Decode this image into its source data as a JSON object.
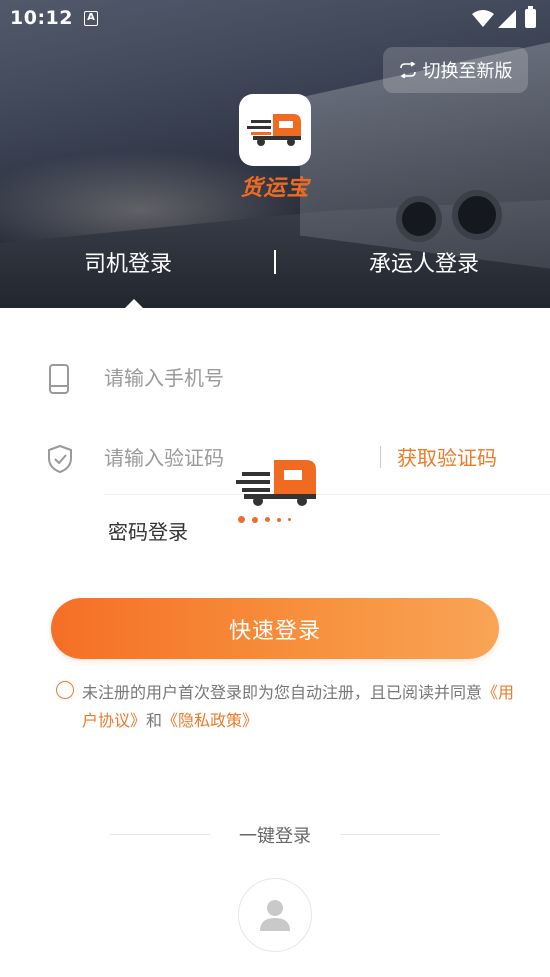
{
  "status_bar": {
    "time": "10:12",
    "notif_letter": "A"
  },
  "header": {
    "switch_version_label": "切换至新版",
    "logo_text": "货运宝",
    "tabs": [
      {
        "label": "司机登录",
        "active": true
      },
      {
        "label": "承运人登录",
        "active": false
      }
    ]
  },
  "form": {
    "phone": {
      "placeholder": "请输入手机号",
      "value": ""
    },
    "code": {
      "placeholder": "请输入验证码",
      "value": "",
      "get_code_label": "获取验证码"
    },
    "password_login_label": "密码登录",
    "submit_label": "快速登录"
  },
  "agreement": {
    "text_before": "未注册的用户首次登录即为您自动注册，且已阅读并同意",
    "user_agreement": "《用户协议》",
    "and": "和",
    "privacy_policy": "《隐私政策》"
  },
  "one_key_login": {
    "label": "一键登录"
  },
  "colors": {
    "accent": "#ee7a2a",
    "button_start": "#f56f25",
    "button_end": "#f9a456"
  },
  "icons": {
    "phone": "phone-icon",
    "shield": "shield-check-icon",
    "switch": "swap-icon",
    "avatar": "user-icon",
    "logo": "truck-logo-icon"
  }
}
